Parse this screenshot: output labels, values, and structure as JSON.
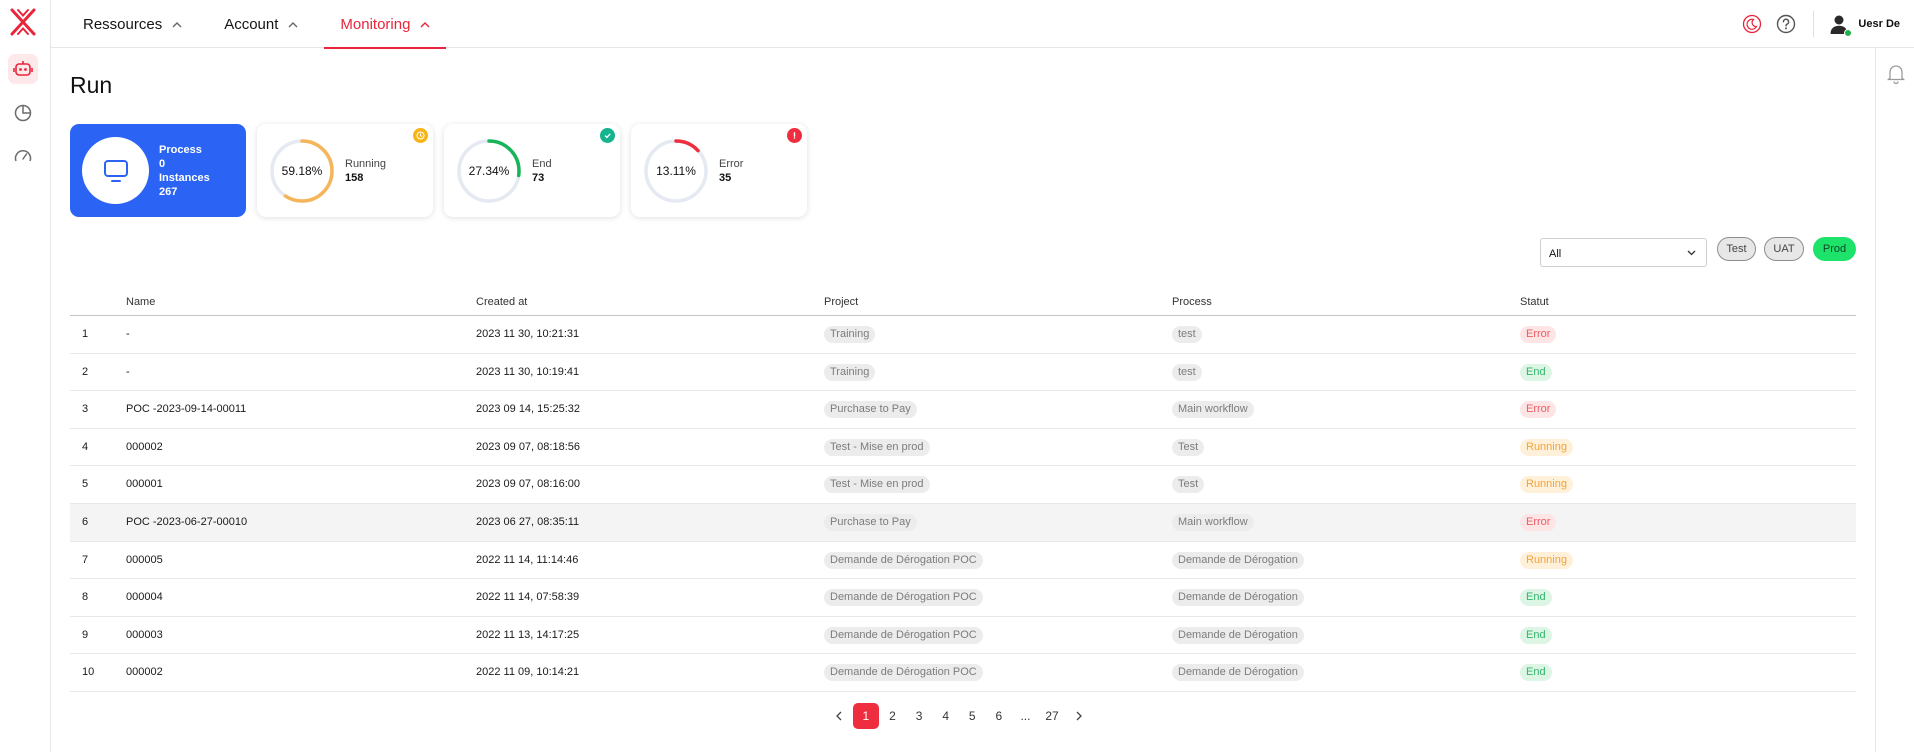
{
  "app": {
    "brand_color": "#e8253b"
  },
  "rail": {
    "items": [
      {
        "icon": "robot-icon",
        "active": true
      },
      {
        "icon": "pie-chart-icon",
        "active": false
      },
      {
        "icon": "gauge-icon",
        "active": false
      }
    ]
  },
  "topnav": {
    "items": [
      {
        "label": "Ressources",
        "active": false
      },
      {
        "label": "Account",
        "active": false
      },
      {
        "label": "Monitoring",
        "active": true
      }
    ],
    "user_name": "Uesr De"
  },
  "page": {
    "title": "Run"
  },
  "summary": {
    "process": {
      "label1": "Process",
      "value1": "0",
      "label2": "Instances",
      "value2": "267"
    },
    "running": {
      "percent": "59.18%",
      "fraction": 0.5918,
      "label": "Running",
      "count": "158",
      "color": "#f7b55a",
      "badge_color": "#f6b417"
    },
    "end": {
      "percent": "27.34%",
      "fraction": 0.2734,
      "label": "End",
      "count": "73",
      "color": "#18b45a",
      "badge_color": "#16b38f"
    },
    "error": {
      "percent": "13.11%",
      "fraction": 0.1311,
      "label": "Error",
      "count": "35",
      "color": "#ee2e3e",
      "badge_color": "#ee2e3e"
    }
  },
  "filters": {
    "select_value": "All",
    "chips": [
      "Test",
      "UAT",
      "Prod"
    ]
  },
  "table": {
    "headers": {
      "num": "",
      "name": "Name",
      "created": "Created at",
      "project": "Project",
      "process": "Process",
      "statut": "Statut"
    },
    "rows": [
      {
        "num": "1",
        "name": "-",
        "created": "2023 11 30, 10:21:31",
        "project": "Training",
        "process": "test",
        "statut": "Error",
        "status_class": "error"
      },
      {
        "num": "2",
        "name": "-",
        "created": "2023 11 30, 10:19:41",
        "project": "Training",
        "process": "test",
        "statut": "End",
        "status_class": "end"
      },
      {
        "num": "3",
        "name": "POC -2023-09-14-00011",
        "created": "2023 09 14, 15:25:32",
        "project": "Purchase to Pay",
        "process": "Main workflow",
        "statut": "Error",
        "status_class": "error"
      },
      {
        "num": "4",
        "name": "000002",
        "created": "2023 09 07, 08:18:56",
        "project": "Test - Mise en prod",
        "process": "Test",
        "statut": "Running",
        "status_class": "running"
      },
      {
        "num": "5",
        "name": "000001",
        "created": "2023 09 07, 08:16:00",
        "project": "Test - Mise en prod",
        "process": "Test",
        "statut": "Running",
        "status_class": "running"
      },
      {
        "num": "6",
        "name": "POC -2023-06-27-00010",
        "created": "2023 06 27, 08:35:11",
        "project": "Purchase to Pay",
        "process": "Main workflow",
        "statut": "Error",
        "status_class": "error"
      },
      {
        "num": "7",
        "name": "000005",
        "created": "2022 11 14, 11:14:46",
        "project": "Demande de Dérogation POC",
        "process": "Demande de Dérogation",
        "statut": "Running",
        "status_class": "running"
      },
      {
        "num": "8",
        "name": "000004",
        "created": "2022 11 14, 07:58:39",
        "project": "Demande de Dérogation POC",
        "process": "Demande de Dérogation",
        "statut": "End",
        "status_class": "end"
      },
      {
        "num": "9",
        "name": "000003",
        "created": "2022 11 13, 14:17:25",
        "project": "Demande de Dérogation POC",
        "process": "Demande de Dérogation",
        "statut": "End",
        "status_class": "end"
      },
      {
        "num": "10",
        "name": "000002",
        "created": "2022 11 09, 10:14:21",
        "project": "Demande de Dérogation POC",
        "process": "Demande de Dérogation",
        "statut": "End",
        "status_class": "end"
      }
    ]
  },
  "pagination": {
    "pages": [
      "1",
      "2",
      "3",
      "4",
      "5",
      "6",
      "...",
      "27"
    ],
    "current": "1"
  }
}
